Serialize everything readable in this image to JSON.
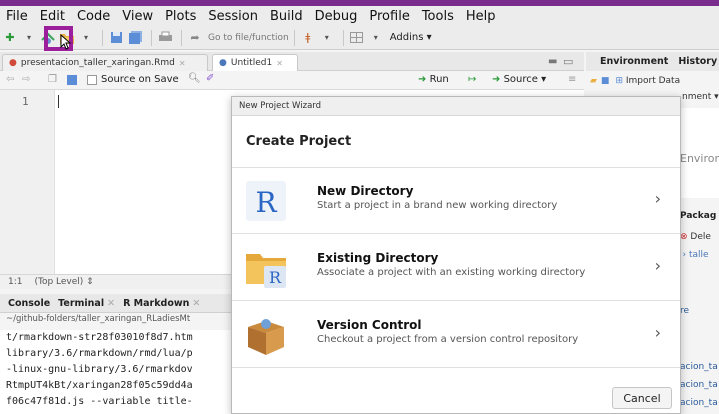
{
  "menubar": {
    "items": [
      "File",
      "Edit",
      "Code",
      "View",
      "Plots",
      "Session",
      "Build",
      "Debug",
      "Profile",
      "Tools",
      "Help"
    ]
  },
  "toolbar": {
    "goto_placeholder": "Go to file/function",
    "addins_label": "Addins"
  },
  "editor": {
    "tabs": [
      {
        "label": "presentacion_taller_xaringan.Rmd"
      },
      {
        "label": "Untitled1"
      }
    ],
    "source_on_save": "Source on Save",
    "run_label": "Run",
    "source_label": "Source",
    "line_number": "1",
    "status_position": "1:1",
    "status_level": "(Top Level)"
  },
  "console": {
    "tabs": [
      "Console",
      "Terminal",
      "R Markdown"
    ],
    "path": "~/github-folders/taller_xaringan_RLadiesMt",
    "lines": [
      "t/rmarkdown-str28f03010f8d7.htm",
      "library/3.6/rmarkdown/rmd/lua/p",
      "-linux-gnu-library/3.6/rmarkdov",
      "RtmpUT4kBt/xaringan28f05c59dd4a",
      "f06c47f81d.js --variable title-"
    ]
  },
  "environment": {
    "tab_env": "Environment",
    "tab_history": "History",
    "import_label": "Import Data",
    "sub_label": "nment",
    "empty_text": "Enviror"
  },
  "files": {
    "tab_packages": "Packag",
    "delete_label": "Dele",
    "crumb": "s › talle",
    "label_re": "re",
    "rows": [
      "acion_ta",
      "acion_ta",
      "acion_ta"
    ]
  },
  "modal": {
    "title": "New Project Wizard",
    "heading": "Create Project",
    "options": [
      {
        "title": "New Directory",
        "subtitle": "Start a project in a brand new working directory",
        "icon": "r-logo-icon"
      },
      {
        "title": "Existing Directory",
        "subtitle": "Associate a project with an existing working directory",
        "icon": "folder-r-icon"
      },
      {
        "title": "Version Control",
        "subtitle": "Checkout a project from a version control repository",
        "icon": "box-icon"
      }
    ],
    "cancel_label": "Cancel"
  },
  "colors": {
    "highlight": "#9b1f9b",
    "top_strip": "#7b2d8e",
    "link_blue": "#2a5a9a"
  }
}
